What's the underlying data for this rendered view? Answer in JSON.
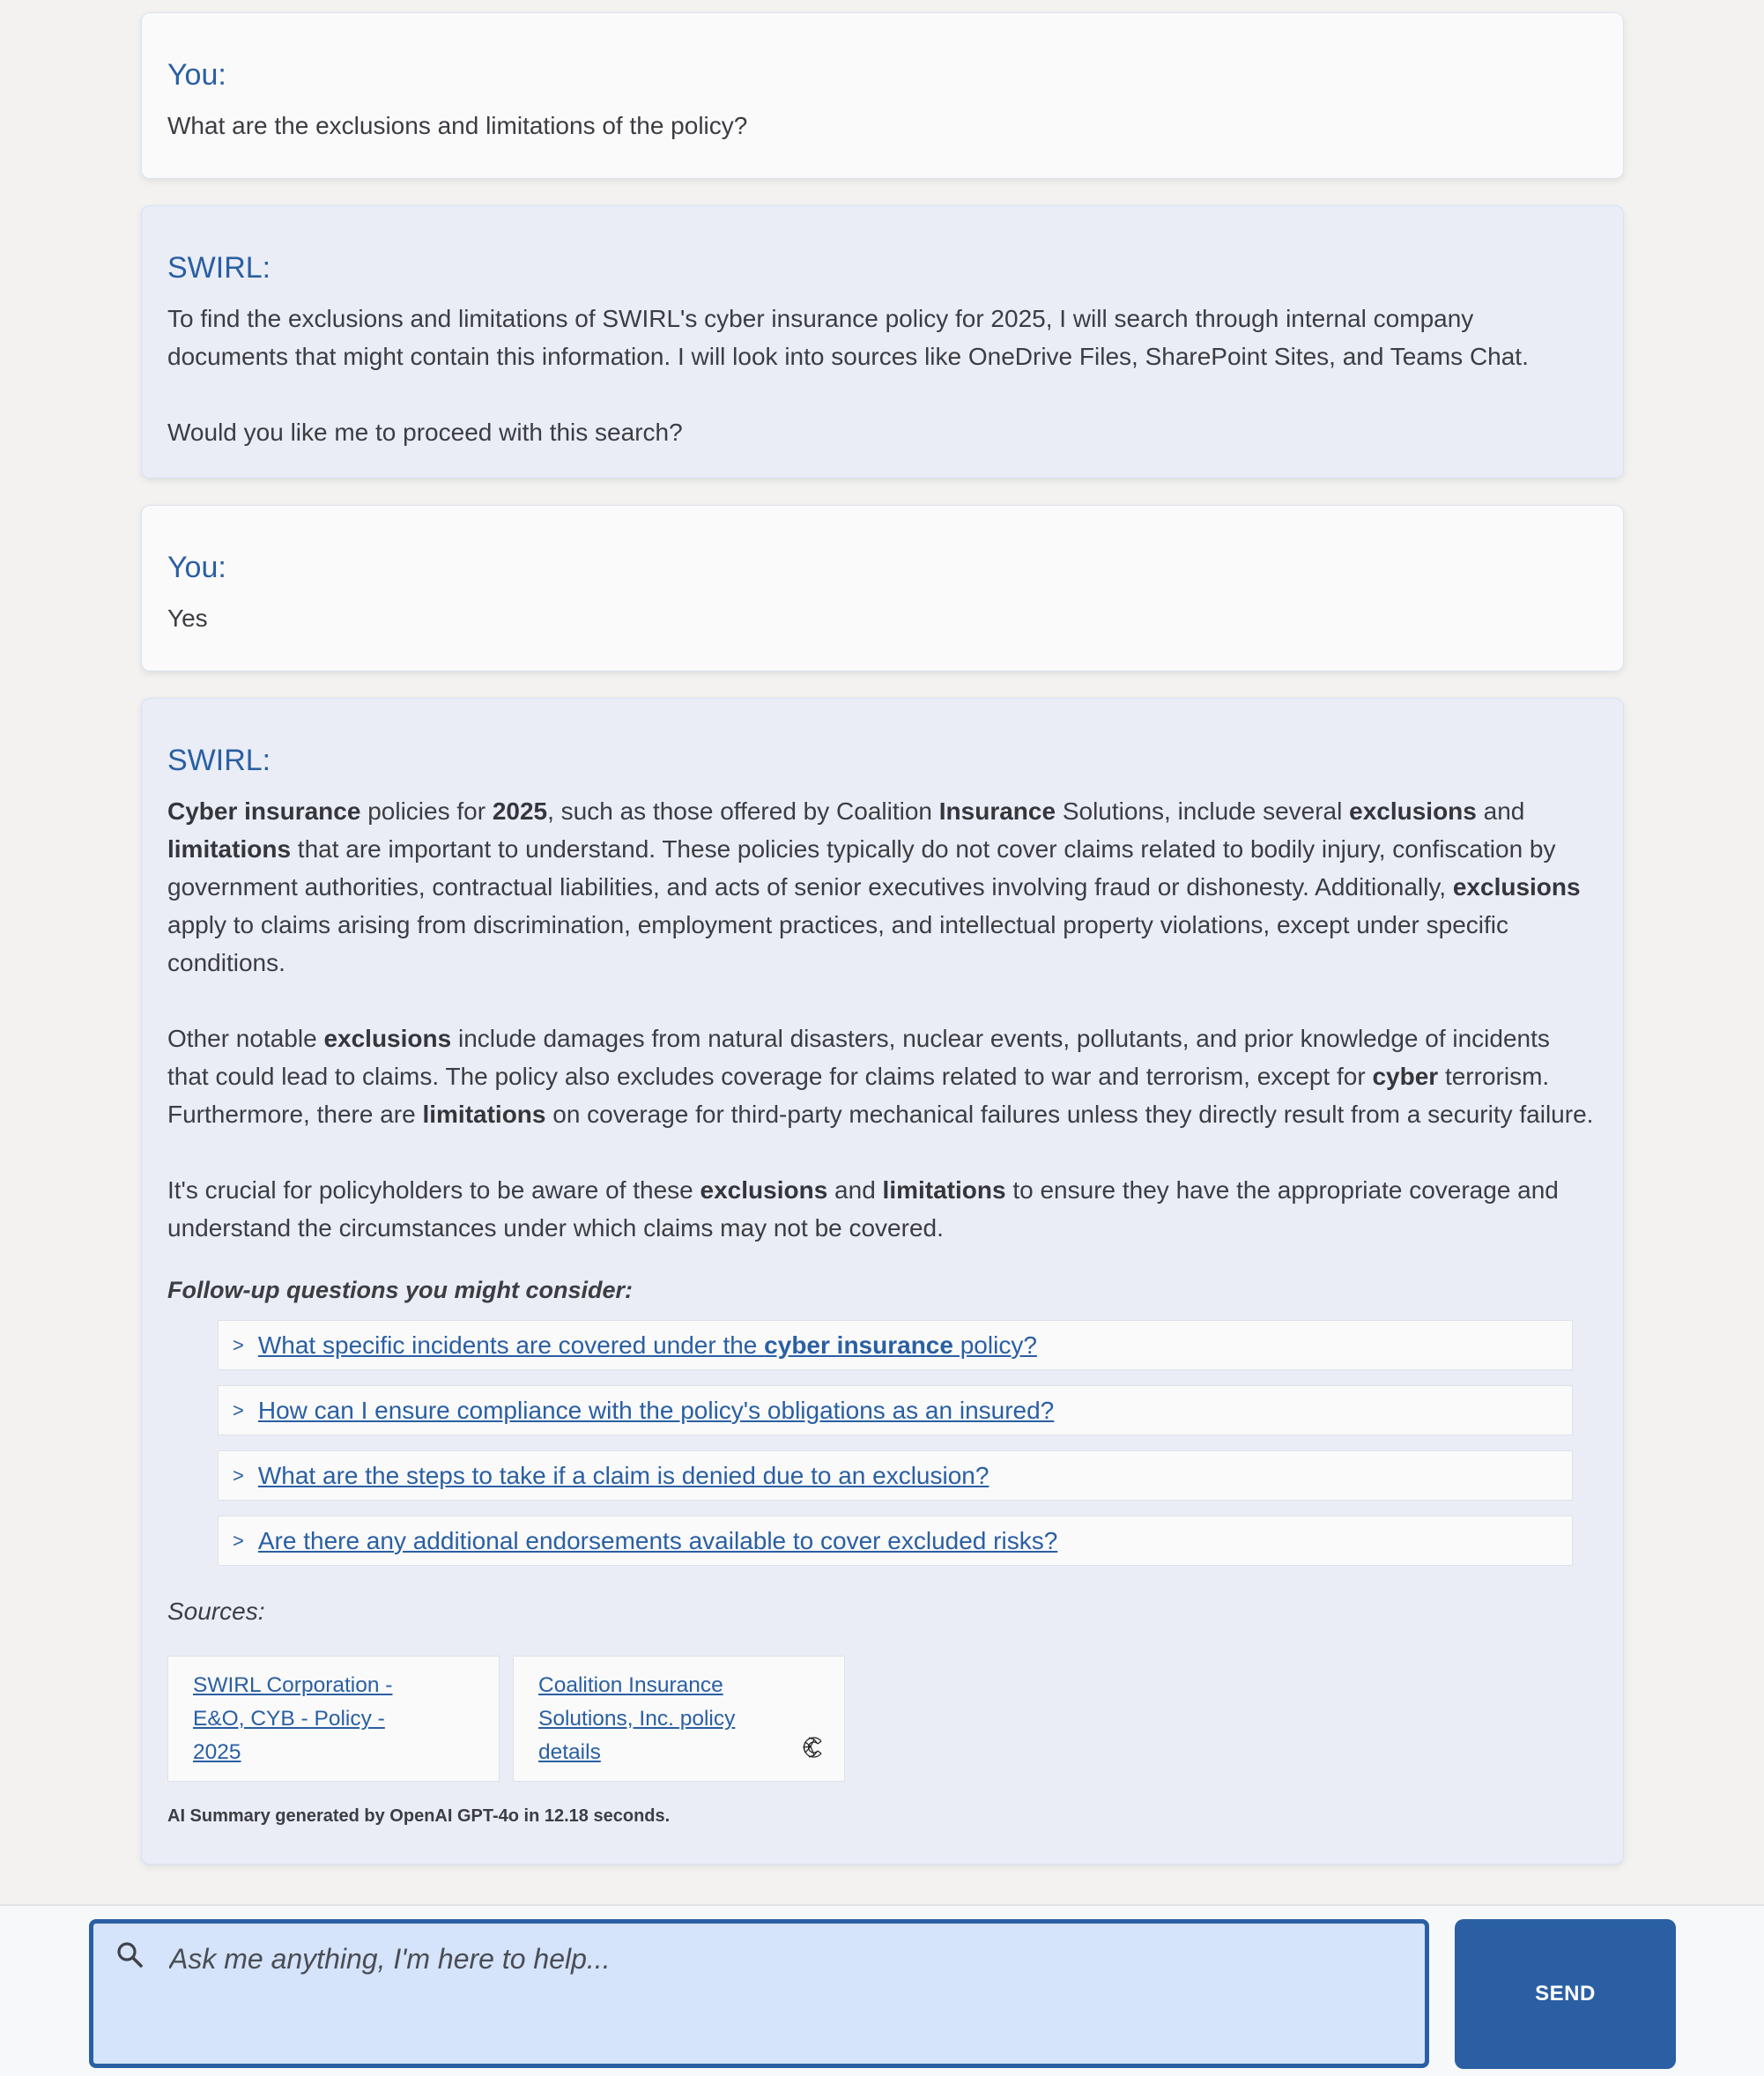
{
  "conversation": [
    {
      "role": "user",
      "speaker": "You:",
      "paragraphs": [
        [
          {
            "t": "What are the exclusions and limitations of the policy?"
          }
        ]
      ]
    },
    {
      "role": "bot",
      "speaker": "SWIRL:",
      "paragraphs": [
        [
          {
            "t": "To find the exclusions and limitations of SWIRL's cyber insurance policy for 2025, I will search through internal company documents that might contain this information. I will look into sources like OneDrive Files, SharePoint Sites, and Teams Chat."
          }
        ],
        [
          {
            "t": "Would you like me to proceed with this search?"
          }
        ]
      ]
    },
    {
      "role": "user",
      "speaker": "You:",
      "paragraphs": [
        [
          {
            "t": "Yes"
          }
        ]
      ]
    },
    {
      "role": "bot",
      "speaker": "SWIRL:",
      "paragraphs": [
        [
          {
            "t": "Cyber insurance",
            "b": true
          },
          {
            "t": " policies for "
          },
          {
            "t": "2025",
            "b": true
          },
          {
            "t": ", such as those offered by Coalition "
          },
          {
            "t": "Insurance",
            "b": true
          },
          {
            "t": " Solutions, include several "
          },
          {
            "t": "exclusions",
            "b": true
          },
          {
            "t": " and "
          },
          {
            "t": "limitations",
            "b": true
          },
          {
            "t": " that are important to understand. These policies typically do not cover claims related to bodily injury, confiscation by government authorities, contractual liabilities, and acts of senior executives involving fraud or dishonesty. Additionally, "
          },
          {
            "t": "exclusions",
            "b": true
          },
          {
            "t": " apply to claims arising from discrimination, employment practices, and intellectual property violations, except under specific conditions."
          }
        ],
        [
          {
            "t": "Other notable "
          },
          {
            "t": "exclusions",
            "b": true
          },
          {
            "t": " include damages from natural disasters, nuclear events, pollutants, and prior knowledge of incidents that could lead to claims. The policy also excludes coverage for claims related to war and terrorism, except for "
          },
          {
            "t": "cyber",
            "b": true
          },
          {
            "t": " terrorism. Furthermore, there are "
          },
          {
            "t": "limitations",
            "b": true
          },
          {
            "t": " on coverage for third-party mechanical failures unless they directly result from a security failure."
          }
        ],
        [
          {
            "t": "It's crucial for policyholders to be aware of these "
          },
          {
            "t": "exclusions",
            "b": true
          },
          {
            "t": " and "
          },
          {
            "t": "limitations",
            "b": true
          },
          {
            "t": " to ensure they have the appropriate coverage and understand the circumstances under which claims may not be covered."
          }
        ]
      ],
      "followup_label": "Follow-up questions you might consider:",
      "followups": [
        {
          "caret": ">",
          "parts": [
            {
              "t": "What specific incidents are covered under the "
            },
            {
              "t": "cyber insurance",
              "b": true
            },
            {
              "t": " policy?"
            }
          ]
        },
        {
          "caret": ">",
          "parts": [
            {
              "t": "How can I ensure compliance with the policy's obligations as an insured?"
            }
          ]
        },
        {
          "caret": ">",
          "parts": [
            {
              "t": "What are the steps to take if a claim is denied due to an exclusion?"
            }
          ]
        },
        {
          "caret": ">",
          "parts": [
            {
              "t": "Are there any additional endorsements available to cover excluded risks?"
            }
          ]
        }
      ],
      "sources_label": "Sources:",
      "sources": [
        {
          "title": "SWIRL Corporation - E&O, CYB - Policy - 2025",
          "icon": ""
        },
        {
          "title": "Coalition Insurance Solutions, Inc. policy details",
          "icon": "coalition-logo-icon"
        }
      ],
      "ai_note": "AI Summary generated by OpenAI GPT-4o in 12.18 seconds."
    }
  ],
  "composer": {
    "placeholder": "Ask me anything, I'm here to help...",
    "value": "",
    "search_icon": "search-icon",
    "send_label": "SEND"
  },
  "colors": {
    "accent": "#2a5fa3",
    "page_bg": "#f3f2f0",
    "bot_card_bg": "#eaedf5",
    "user_card_bg": "#fafafa",
    "input_bg": "#d5e3fb"
  }
}
